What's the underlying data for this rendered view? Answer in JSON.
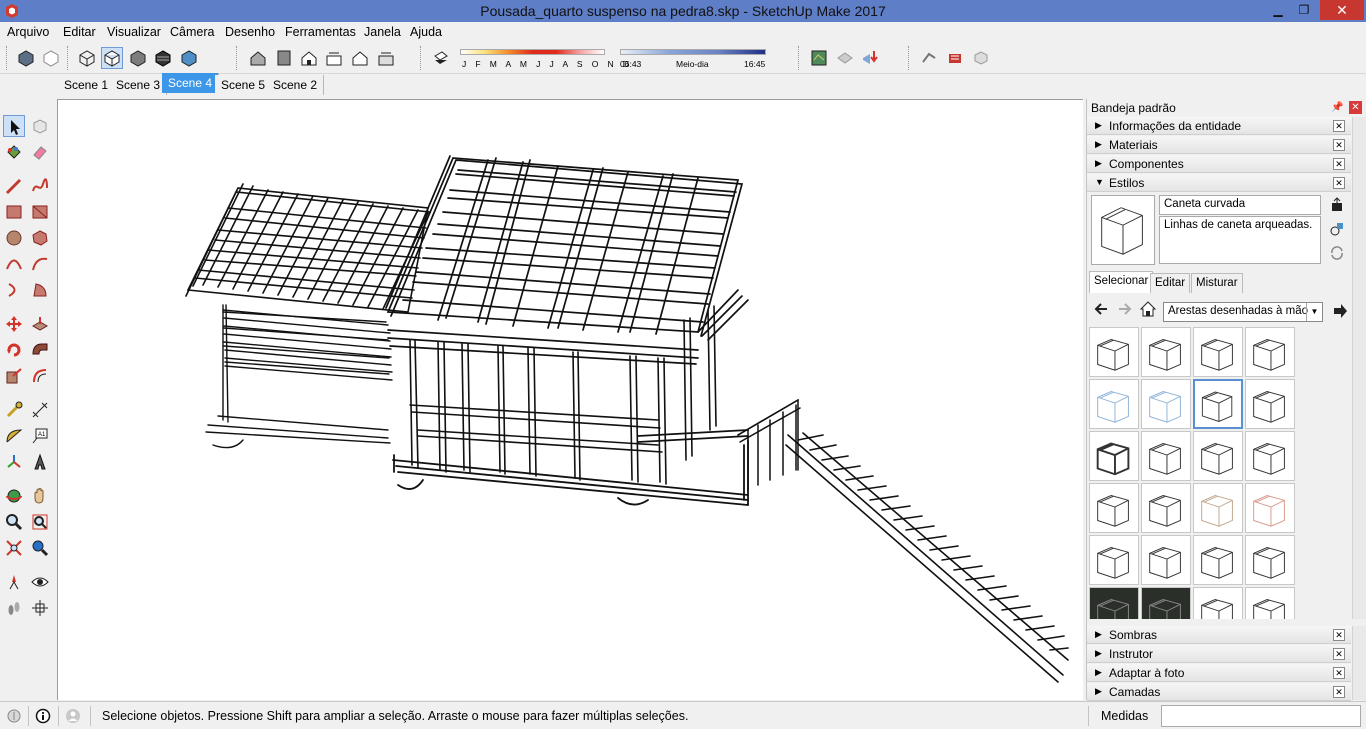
{
  "window": {
    "title": "Pousada_quarto suspenso na pedra8.skp - SketchUp Make 2017",
    "minimize_label": "▁",
    "maximize_label": "❐",
    "close_label": "✕"
  },
  "menu": {
    "items": [
      "Arquivo",
      "Editar",
      "Visualizar",
      "Câmera",
      "Desenho",
      "Ferramentas",
      "Janela",
      "Ajuda"
    ]
  },
  "shadow": {
    "months": "J F M A M J J A S O N D",
    "time_start": "06:43",
    "time_mid": "Meio-dia",
    "time_end": "16:45"
  },
  "scenes": {
    "tabs": [
      "Scene 1",
      "Scene 3",
      "Scene 4",
      "Scene 5",
      "Scene 2"
    ],
    "active_index": 2
  },
  "tray": {
    "title": "Bandeja padrão",
    "panels_top": [
      "Informações da entidade",
      "Materiais",
      "Componentes",
      "Estilos"
    ],
    "style_name": "Caneta curvada",
    "style_description": "Linhas de caneta arqueadas.",
    "sub_tabs": [
      "Selecionar",
      "Editar",
      "Misturar"
    ],
    "collection": "Arestas desenhadas à mão",
    "panels_bottom": [
      "Sombras",
      "Instrutor",
      "Adaptar à foto",
      "Camadas"
    ]
  },
  "status": {
    "message": "Selecione objetos. Pressione Shift para ampliar a seleção. Arraste o mouse para fazer múltiplas seleções.",
    "measure_label": "Medidas",
    "measure_value": ""
  },
  "colors": {
    "titlebar": "#5f7ec8",
    "active_tab": "#3c97e8",
    "close_red": "#c7372f",
    "selection_blue": "#5a8fd0"
  }
}
